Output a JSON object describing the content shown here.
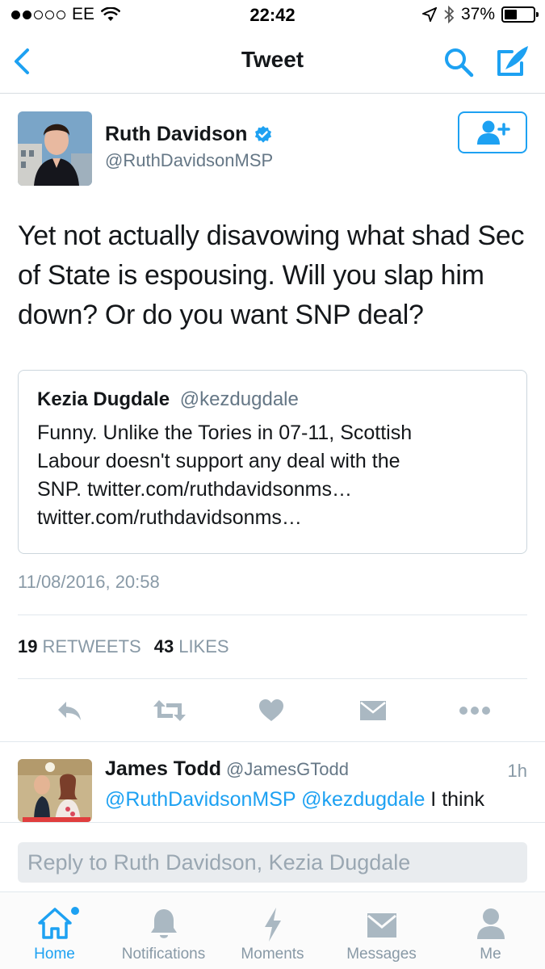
{
  "status_bar": {
    "carrier": "EE",
    "time": "22:42",
    "battery": "37%"
  },
  "nav": {
    "title": "Tweet"
  },
  "tweet": {
    "author_name": "Ruth Davidson",
    "author_handle": "@RuthDavidsonMSP",
    "text": "Yet not actually disavowing what shad Sec of State is espousing. Will you slap him down? Or do you want SNP deal?",
    "timestamp": "11/08/2016, 20:58",
    "retweets": "19",
    "retweets_label": "RETWEETS",
    "likes": "43",
    "likes_label": "LIKES"
  },
  "quote": {
    "name": "Kezia Dugdale",
    "handle": "@kezdugdale",
    "text_line1": "Funny. Unlike the Tories in 07-11, Scottish",
    "text_line2": "Labour doesn't support any deal with the",
    "text_line3": "SNP. twitter.com/ruthdavidsonms…",
    "text_line4": "twitter.com/ruthdavidsonms…"
  },
  "reply": {
    "name": "James Todd",
    "handle": "@JamesGTodd",
    "time": "1h",
    "mention1": "@RuthDavidsonMSP",
    "mention2": "@kezdugdale",
    "text": " I think"
  },
  "reply_box": {
    "placeholder": "Reply to Ruth Davidson, Kezia Dugdale"
  },
  "tabs": [
    {
      "label": "Home",
      "icon": "home-icon"
    },
    {
      "label": "Notifications",
      "icon": "bell-icon"
    },
    {
      "label": "Moments",
      "icon": "lightning-icon"
    },
    {
      "label": "Messages",
      "icon": "envelope-icon"
    },
    {
      "label": "Me",
      "icon": "person-icon"
    }
  ],
  "colors": {
    "accent": "#1da1f2",
    "text": "#14171a",
    "muted": "#8899a6"
  }
}
